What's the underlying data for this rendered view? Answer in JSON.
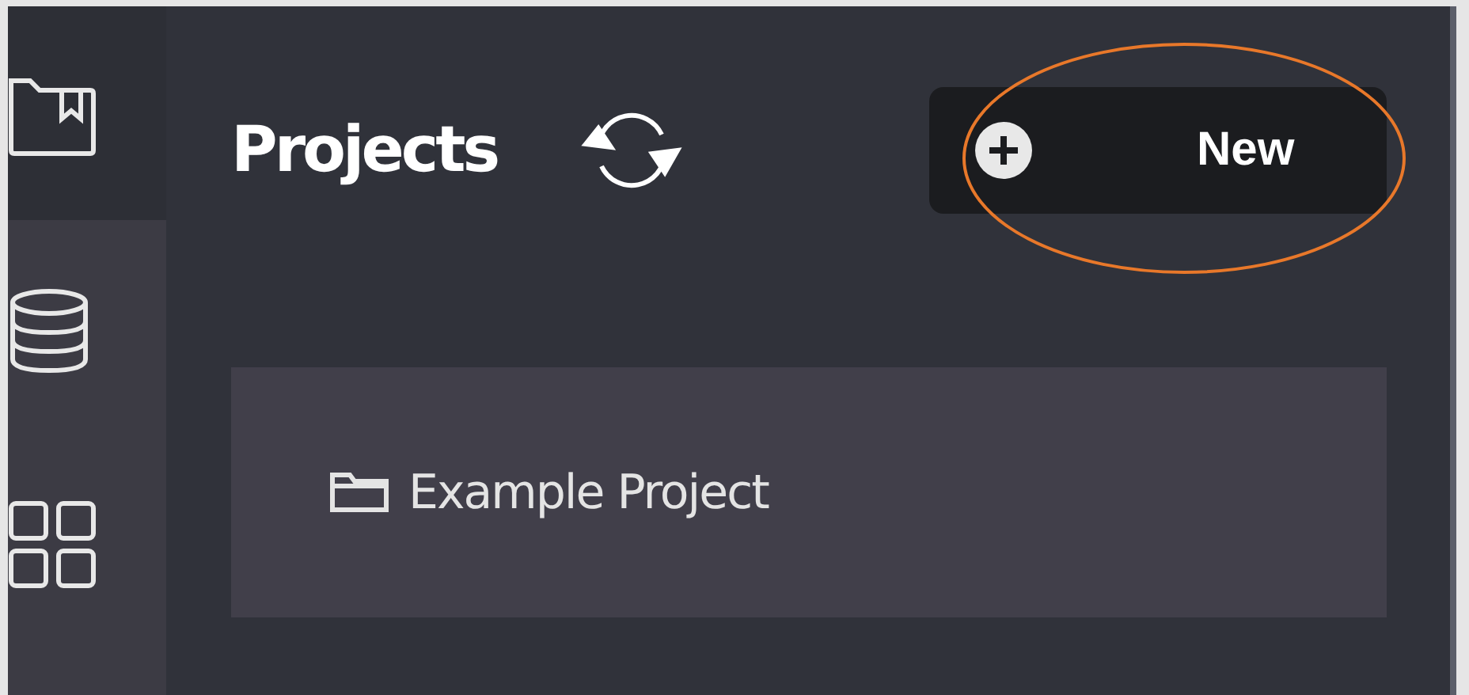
{
  "sidebar": {
    "items": [
      {
        "kind": "bookmark-folder",
        "selected": true
      },
      {
        "kind": "database",
        "selected": false
      },
      {
        "kind": "grid",
        "selected": false
      }
    ]
  },
  "header": {
    "title": "Projects",
    "new_button": "New"
  },
  "projects": [
    {
      "name": "Example Project"
    }
  ]
}
